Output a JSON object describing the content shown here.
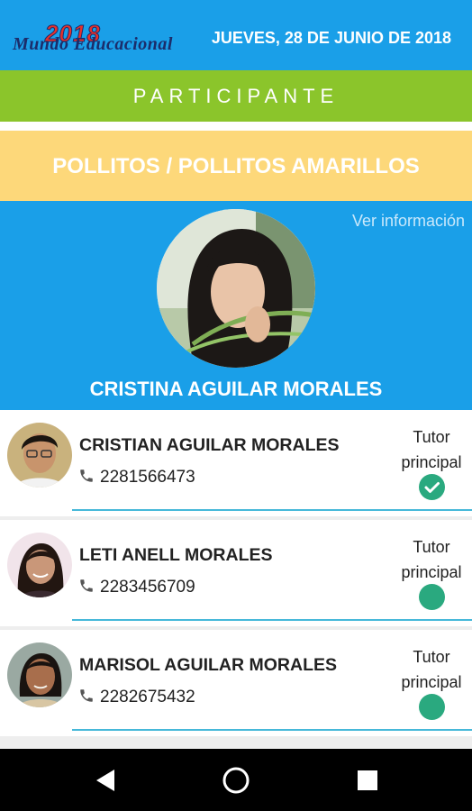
{
  "header": {
    "logo_year": "2018",
    "logo_script": "Mundo Educacional",
    "date": "JUEVES, 28 DE JUNIO DE 2018"
  },
  "section_label": "PARTICIPANTE",
  "group": "POLLITOS / POLLITOS AMARILLOS",
  "profile": {
    "link": "Ver información",
    "name": "CRISTINA AGUILAR MORALES"
  },
  "tutors": [
    {
      "name": "CRISTIAN AGUILAR MORALES",
      "phone": "2281566473",
      "role": "Tutor principal",
      "selected": true
    },
    {
      "name": "LETI ANELL MORALES",
      "phone": "2283456709",
      "role": "Tutor principal",
      "selected": false
    },
    {
      "name": "MARISOL AGUILAR MORALES",
      "phone": "2282675432",
      "role": "Tutor principal",
      "selected": false
    }
  ],
  "colors": {
    "primary_blue": "#1a9fe8",
    "green_bar": "#8bc52b",
    "yellow_bar": "#fdd87a",
    "check_green": "#2aa97f",
    "divider": "#46b8d9"
  },
  "navbar": {
    "icons": [
      "back-icon",
      "home-icon",
      "recents-icon"
    ]
  }
}
